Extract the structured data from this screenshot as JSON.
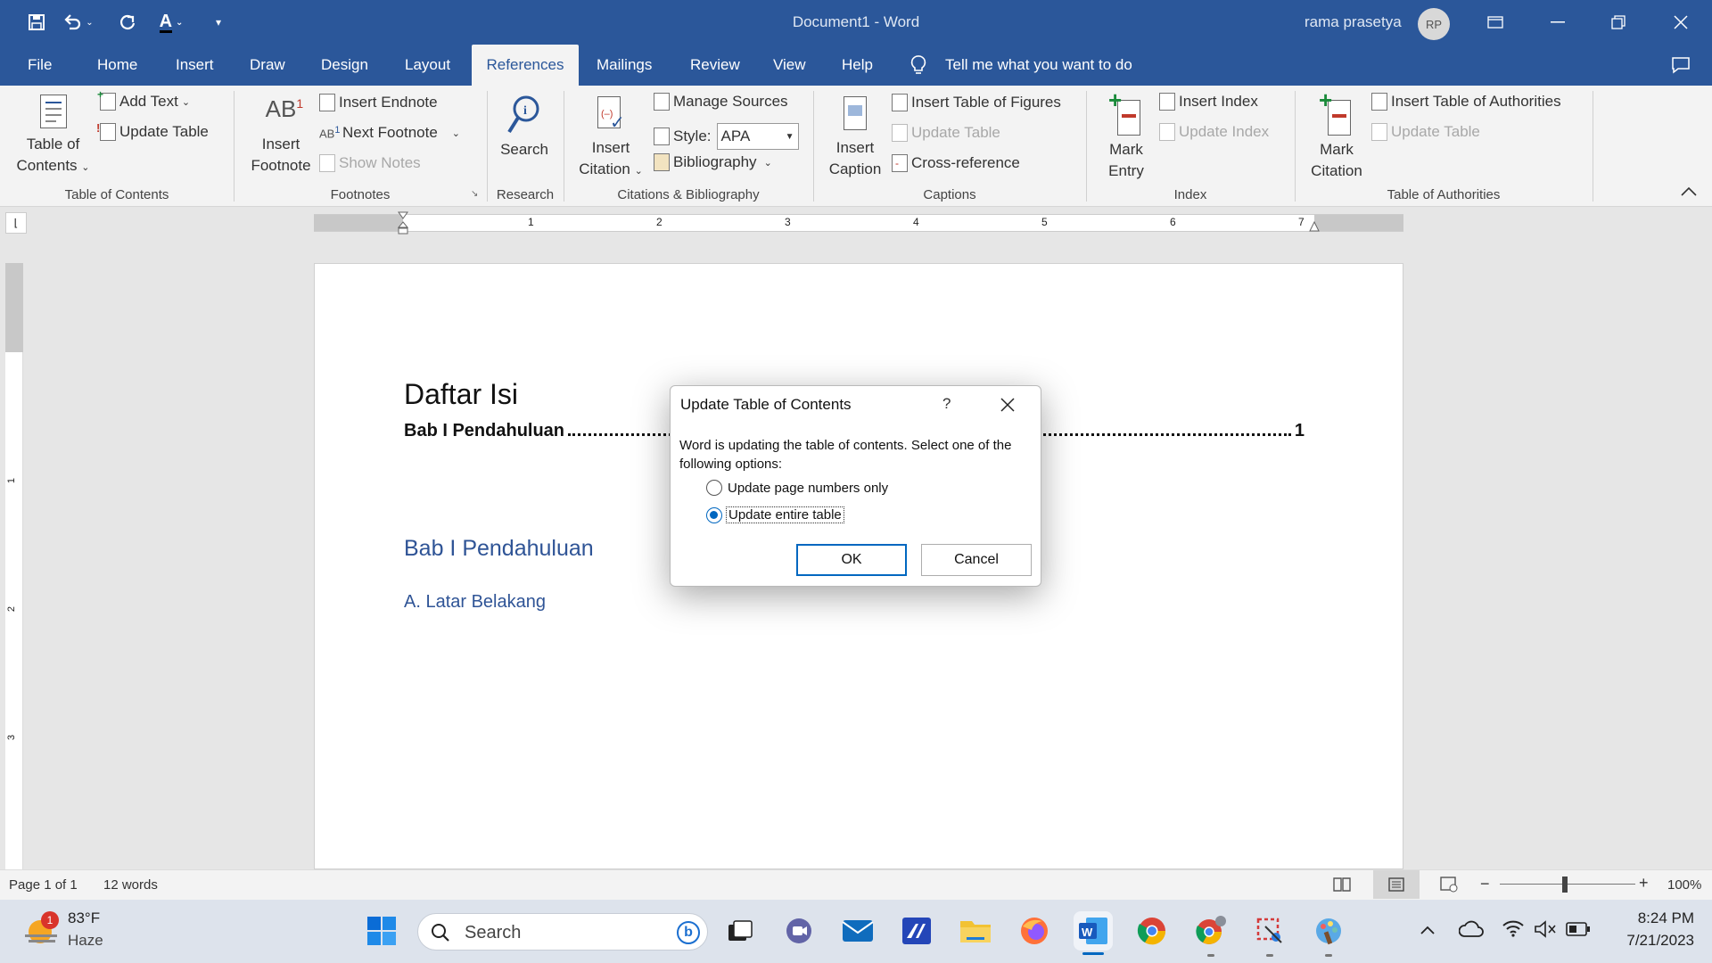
{
  "titlebar": {
    "title": "Document1 - Word",
    "user_name": "rama prasetya",
    "avatar_initials": "RP",
    "accent_color": "#2b579a"
  },
  "tabs": [
    "File",
    "Home",
    "Insert",
    "Draw",
    "Design",
    "Layout",
    "References",
    "Mailings",
    "Review",
    "View",
    "Help"
  ],
  "active_tab": "References",
  "tell_me": "Tell me what you want to do",
  "ribbon": {
    "toc": {
      "big_label_1": "Table of",
      "big_label_2": "Contents",
      "add_text": "Add Text",
      "update_table": "Update Table",
      "group": "Table of Contents"
    },
    "footnotes": {
      "big_label_1": "Insert",
      "big_label_2": "Footnote",
      "insert_endnote": "Insert Endnote",
      "next_footnote": "Next Footnote",
      "show_notes": "Show Notes",
      "group": "Footnotes"
    },
    "research": {
      "search": "Search",
      "group": "Research"
    },
    "citations": {
      "big_label_1": "Insert",
      "big_label_2": "Citation",
      "manage_sources": "Manage Sources",
      "style_label": "Style:",
      "style_value": "APA",
      "bibliography": "Bibliography",
      "group": "Citations & Bibliography"
    },
    "captions": {
      "big_label_1": "Insert",
      "big_label_2": "Caption",
      "insert_tof": "Insert Table of Figures",
      "update_table": "Update Table",
      "cross_reference": "Cross-reference",
      "group": "Captions"
    },
    "index": {
      "big_label_1": "Mark",
      "big_label_2": "Entry",
      "insert_index": "Insert Index",
      "update_index": "Update Index",
      "group": "Index"
    },
    "authorities": {
      "big_label_1": "Mark",
      "big_label_2": "Citation",
      "insert_toa": "Insert Table of Authorities",
      "update_table": "Update Table",
      "group": "Table of Authorities"
    }
  },
  "ruler_numbers": [
    "1",
    "2",
    "3",
    "4",
    "5",
    "6",
    "7"
  ],
  "vruler_numbers": [
    "1",
    "2",
    "3"
  ],
  "document": {
    "toc_heading": "Daftar Isi",
    "toc_entry": "Bab I Pendahuluan",
    "toc_page": "1",
    "heading1": "Bab I Pendahuluan",
    "heading2": "A. Latar Belakang",
    "heading_color": "#2f5496"
  },
  "dialog": {
    "title": "Update Table of Contents",
    "help": "?",
    "message": "Word is updating the table of contents.  Select one of the following options:",
    "option1": "Update page numbers only",
    "option2": "Update entire table",
    "selected_option": "Update entire table",
    "ok": "OK",
    "cancel": "Cancel"
  },
  "statusbar": {
    "page": "Page 1 of 1",
    "words": "12 words",
    "zoom": "100%"
  },
  "taskbar": {
    "temperature": "83°F",
    "weather": "Haze",
    "weather_badge": "1",
    "search_placeholder": "Search",
    "time": "8:24 PM",
    "date": "7/21/2023"
  }
}
